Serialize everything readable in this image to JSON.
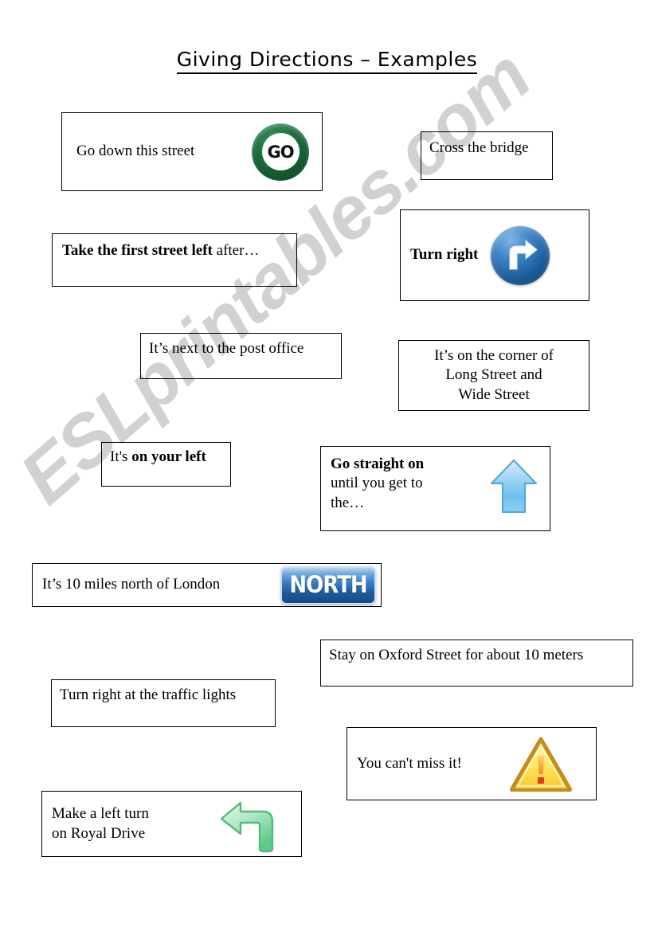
{
  "page": {
    "title": "Giving Directions – Examples",
    "watermark": "ESLprintables.com",
    "background_color": "#ffffff",
    "border_color": "#000000"
  },
  "cards": [
    {
      "id": "go-down-this-street",
      "text": "Go down this street",
      "icon": "go-badge-icon",
      "icon_label": "GO",
      "icon_color": "#1d6b3b"
    },
    {
      "id": "cross-the-bridge",
      "text": "Cross the bridge",
      "icon": null
    },
    {
      "id": "take-first-street-left",
      "text_bold": "Take the first street left",
      "text_regular": " after…",
      "icon": null
    },
    {
      "id": "turn-right",
      "text": "Turn right",
      "icon": "turn-right-sphere-icon",
      "icon_color": "#1f5f9e"
    },
    {
      "id": "next-to-post-office",
      "text": "It’s next to the post office",
      "icon": null
    },
    {
      "id": "on-the-corner",
      "text": "It’s on the corner of\nLong Street and\nWide Street",
      "icon": null
    },
    {
      "id": "on-your-left",
      "text_regular": "It's ",
      "text_bold": "on your left",
      "icon": null
    },
    {
      "id": "go-straight-on",
      "text_bold": "Go straight on",
      "text_regular": "until you get to\nthe…",
      "icon": "up-arrow-icon",
      "icon_color": "#5ab4e8"
    },
    {
      "id": "ten-miles-north",
      "text": "It’s 10 miles north of London",
      "icon": "north-sign-icon",
      "icon_label": "NORTH",
      "icon_color": "#1f5fa3"
    },
    {
      "id": "stay-on-oxford-street",
      "text": "Stay on Oxford Street for about 10 meters",
      "icon": null
    },
    {
      "id": "turn-right-traffic-lights",
      "text": "Turn right at the traffic lights",
      "icon": null
    },
    {
      "id": "cant-miss-it",
      "text": "You can't miss it!",
      "icon": "warning-triangle-icon",
      "icon_color": "#f5c518"
    },
    {
      "id": "make-a-left-turn",
      "text": "Make a left turn\non Royal Drive",
      "icon": "left-turn-arrow-icon",
      "icon_color": "#7fd49a"
    }
  ]
}
